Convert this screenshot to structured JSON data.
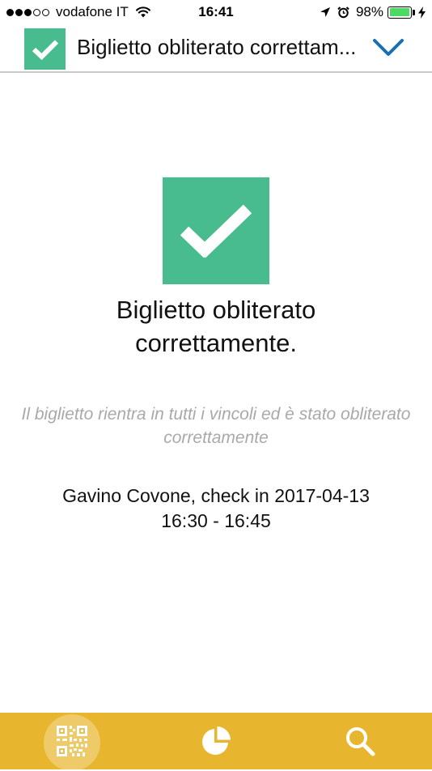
{
  "status_bar": {
    "carrier": "vodafone IT",
    "time": "16:41",
    "battery_percent": "98%",
    "battery_level": 0.98,
    "signal_bars_filled": 3,
    "signal_bars_total": 5
  },
  "header": {
    "title": "Biglietto obliterato correttamente."
  },
  "result": {
    "title": "Biglietto obliterato correttamente.",
    "description": "Il biglietto rientra in tutti i vincoli ed è stato obliterato correttamente",
    "checkin_line1": "Gavino Covone, check in 2017-04-13",
    "checkin_line2": "16:30 - 16:45"
  },
  "tabs": [
    {
      "icon": "qr-code-icon",
      "active": true
    },
    {
      "icon": "pie-chart-icon",
      "active": false
    },
    {
      "icon": "search-icon",
      "active": false
    }
  ],
  "colors": {
    "success_green": "#48bb8f",
    "tab_bar_yellow": "#e8b62e",
    "chevron_blue": "#1a6fb0",
    "muted_text": "#a9a9a9"
  }
}
